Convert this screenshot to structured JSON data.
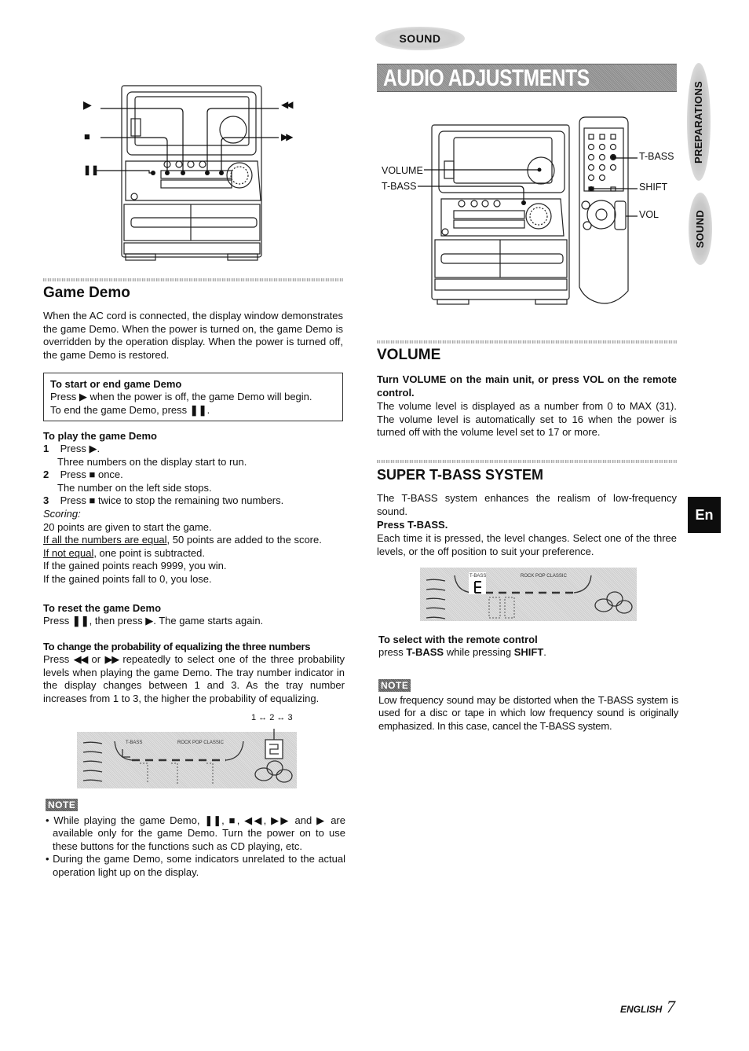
{
  "header": {
    "section_pill": "SOUND",
    "title": "AUDIO ADJUSTMENTS"
  },
  "side_tabs": [
    {
      "label": "PREPARATIONS"
    },
    {
      "label": "SOUND"
    }
  ],
  "language_tab": "En",
  "left_figure": {
    "labels": {
      "play": "▶",
      "stop": "■",
      "pause": "❚❚",
      "rewind": "◀◀",
      "fast_forward": "▶▶"
    }
  },
  "right_figure": {
    "labels": {
      "volume": "VOLUME",
      "tbass_main": "T-BASS",
      "tbass_remote": "T-BASS",
      "shift": "SHIFT",
      "vol": "VOL"
    }
  },
  "game_demo": {
    "title": "Game Demo",
    "intro": "When the AC cord is connected, the display window demonstrates the game Demo. When the power is turned on, the game Demo is overridden by the operation display. When the power is turned off, the game Demo is restored.",
    "start_end": {
      "heading": "To start or end game Demo",
      "line1_a": "Press",
      "line1_icon": "▶",
      "line1_b": "when the power is off, the game Demo will begin.",
      "line2_a": "To end the game Demo, press",
      "line2_icon": "❚❚",
      "line2_b": "."
    },
    "play": {
      "heading": "To play the game Demo",
      "steps": [
        {
          "num": "1",
          "text_a": "Press",
          "icon": "▶",
          "text_b": ".",
          "detail": "Three numbers on the display start to run."
        },
        {
          "num": "2",
          "text_a": "Press",
          "icon": "■",
          "text_b": "once.",
          "detail": "The number on the left side stops."
        },
        {
          "num": "3",
          "text_a": "Press",
          "icon": "■",
          "text_b": "twice to stop the remaining two numbers.",
          "detail": ""
        }
      ],
      "scoring_label": "Scoring:",
      "scoring": [
        {
          "underlined": "",
          "text": "20 points are given to start the game."
        },
        {
          "underlined": "If all the numbers are equal",
          "text": ", 50 points are added to the score."
        },
        {
          "underlined": "If not equal",
          "text": ", one point is subtracted."
        },
        {
          "underlined": "",
          "text": "If the gained points reach 9999, you win."
        },
        {
          "underlined": "",
          "text": "If the gained points fall to 0, you lose."
        }
      ]
    },
    "reset": {
      "heading": "To reset the game Demo",
      "text_a": "Press",
      "icon1": "❚❚",
      "text_b": ", then press",
      "icon2": "▶",
      "text_c": ". The game starts again."
    },
    "probability": {
      "heading": "To change the probability of equalizing the three numbers",
      "text_a": "Press",
      "icon1": "◀◀",
      "text_b": "or",
      "icon2": "▶▶",
      "text_c": "repeatedly to select one of the three probability levels when playing the game Demo. The tray number indicator in the display changes between 1 and 3. As the tray number increases from 1 to 3, the higher the probability of equalizing."
    },
    "display": {
      "cycle": "1 ↔ 2 ↔ 3",
      "indicator_tbass": "T-BASS",
      "indicator_modes": "ROCK  POP CLASSIC",
      "tray_number": "2"
    },
    "note": {
      "badge": "NOTE",
      "bullets": [
        "While playing the game Demo, ❚❚, ■, ◀◀, ▶▶ and ▶ are available only for the game Demo. Turn the power on to use these buttons for the functions such as CD playing, etc.",
        "During the game Demo, some indicators unrelated to the actual operation light up on the display."
      ]
    }
  },
  "volume": {
    "title": "VOLUME",
    "instruction": "Turn VOLUME on the main unit, or press VOL on the remote control.",
    "body": "The volume level is displayed as a number from 0 to MAX (31). The volume level is automatically set to 16 when the power is turned off with the volume level set to 17 or more."
  },
  "tbass": {
    "title": "SUPER T-BASS SYSTEM",
    "intro": "The T-BASS system enhances the realism of low-frequency sound.",
    "instruction": "Press T-BASS.",
    "body": "Each time it is pressed, the level changes.  Select one of the three levels, or the off position to suit your preference.",
    "display": {
      "indicator_tbass": "T-BASS",
      "indicator_modes": "ROCK  POP CLASSIC"
    },
    "remote": {
      "heading": "To select with the remote control",
      "text_a": "press",
      "bold1": "T-BASS",
      "text_b": "while pressing",
      "bold2": "SHIFT",
      "text_c": "."
    },
    "note": {
      "badge": "NOTE",
      "text": "Low frequency sound may be distorted when the T-BASS system is used for a disc or tape in which low frequency sound is originally emphasized. In this case, cancel the T-BASS system."
    }
  },
  "footer": {
    "language": "ENGLISH",
    "page_number": "7"
  }
}
